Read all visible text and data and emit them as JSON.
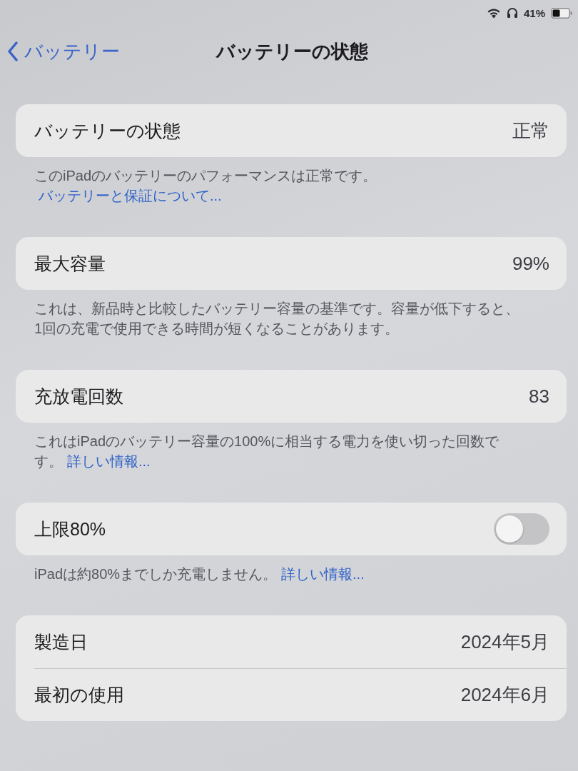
{
  "status_bar": {
    "battery_text": "41%"
  },
  "nav": {
    "back_label": "バッテリー",
    "title": "バッテリーの状態"
  },
  "sections": [
    {
      "rows": [
        {
          "kind": "value",
          "label": "バッテリーの状態",
          "value": "正常"
        }
      ],
      "footer": {
        "text": "このiPadのバッテリーのパフォーマンスは正常です。",
        "link": "バッテリーと保証について..."
      }
    },
    {
      "rows": [
        {
          "kind": "value",
          "label": "最大容量",
          "value": "99%"
        }
      ],
      "footer": {
        "text": "これは、新品時と比較したバッテリー容量の基準です。容量が低下すると、1回の充電で使用できる時間が短くなることがあります。"
      }
    },
    {
      "rows": [
        {
          "kind": "value",
          "label": "充放電回数",
          "value": "83"
        }
      ],
      "footer": {
        "text": "これはiPadのバッテリー容量の100%に相当する電力を使い切った回数です。",
        "link": "詳しい情報..."
      }
    },
    {
      "rows": [
        {
          "kind": "toggle",
          "label": "上限80%",
          "on": false
        }
      ],
      "footer": {
        "text": "iPadは約80%までしか充電しません。",
        "link": "詳しい情報..."
      }
    },
    {
      "rows": [
        {
          "kind": "value",
          "label": "製造日",
          "value": "2024年5月"
        },
        {
          "kind": "value",
          "label": "最初の使用",
          "value": "2024年6月"
        }
      ]
    }
  ]
}
